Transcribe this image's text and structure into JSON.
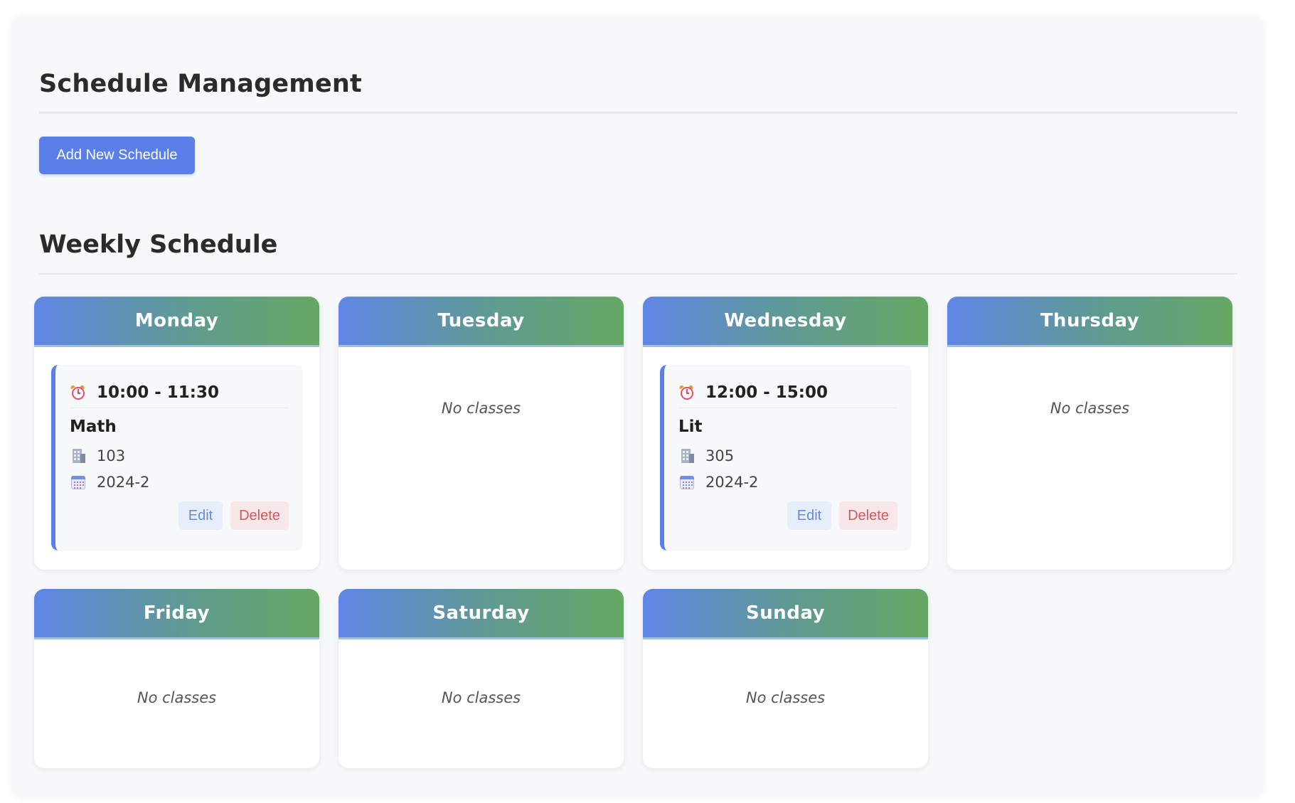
{
  "header": {
    "title": "Schedule Management",
    "add_button_label": "Add New Schedule"
  },
  "weekly": {
    "title": "Weekly Schedule",
    "empty_label": "No classes"
  },
  "colors": {
    "accent": "#5b7fe8",
    "header_gradient_start": "#5f86e6",
    "header_gradient_end": "#66a864",
    "delete_text": "#cf5a5f"
  },
  "days": [
    {
      "name": "Monday",
      "entries": [
        {
          "time": "10:00 - 11:30",
          "subject": "Math",
          "room": "103",
          "term": "2024-2",
          "edit_label": "Edit",
          "delete_label": "Delete"
        }
      ]
    },
    {
      "name": "Tuesday",
      "entries": []
    },
    {
      "name": "Wednesday",
      "entries": [
        {
          "time": "12:00 - 15:00",
          "subject": "Lit",
          "room": "305",
          "term": "2024-2",
          "edit_label": "Edit",
          "delete_label": "Delete"
        }
      ]
    },
    {
      "name": "Thursday",
      "entries": []
    },
    {
      "name": "Friday",
      "entries": []
    },
    {
      "name": "Saturday",
      "entries": []
    },
    {
      "name": "Sunday",
      "entries": []
    }
  ],
  "icons": {
    "time": "alarm-clock-icon",
    "room": "building-icon",
    "term": "calendar-icon"
  }
}
